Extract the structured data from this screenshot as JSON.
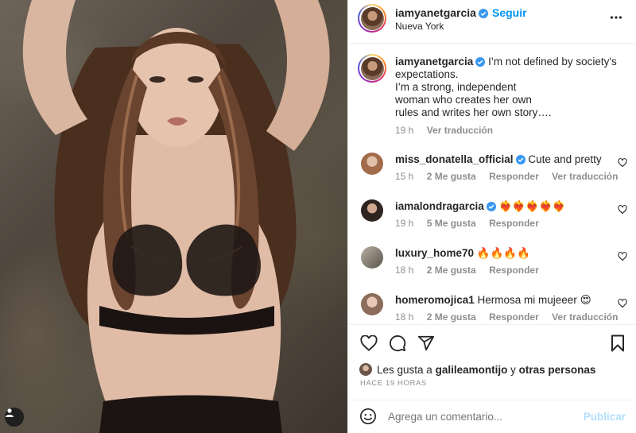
{
  "post": {
    "author": "iamyanetgarcia",
    "follow_label": "Seguir",
    "location": "Nueva York",
    "more_icon": "more-horizontal-icon"
  },
  "caption": {
    "username": "iamyanetgarcia",
    "text": " I’m not defined by society's expectations.\nI’m a strong, independent\nwoman who creates her own\nrules and writes her own story….",
    "time": "19 h",
    "translate": "Ver traducción"
  },
  "comments": [
    {
      "username": "miss_donatella_official",
      "verified": true,
      "text": " Cute and pretty",
      "time": "15 h",
      "likes": "2 Me gusta",
      "reply": "Responder",
      "translate": "Ver traducción"
    },
    {
      "username": "iamalondragarcia",
      "verified": true,
      "text": " ❤️‍🔥❤️‍🔥❤️‍🔥❤️‍🔥❤️‍🔥",
      "time": "19 h",
      "likes": "5 Me gusta",
      "reply": "Responder",
      "translate": ""
    },
    {
      "username": "luxury_home70",
      "verified": false,
      "text": " 🔥🔥🔥🔥",
      "time": "18 h",
      "likes": "2 Me gusta",
      "reply": "Responder",
      "translate": ""
    },
    {
      "username": "homeromojica1",
      "verified": false,
      "text": " Hermosa mi mujeeer 😍",
      "time": "18 h",
      "likes": "2 Me gusta",
      "reply": "Responder",
      "translate": "Ver traducción"
    }
  ],
  "likes_summary": {
    "prefix": "Les gusta a ",
    "user": "galileamontijo",
    "middle": " y ",
    "others": "otras personas"
  },
  "time_ago": "HACE 19 HORAS",
  "composer": {
    "placeholder": "Agrega un comentario...",
    "publish_label": "Publicar"
  },
  "colors": {
    "accent": "#0095f6",
    "verified": "#3897f0",
    "muted": "#8e8e8e",
    "publish_disabled": "#b2dffc"
  }
}
